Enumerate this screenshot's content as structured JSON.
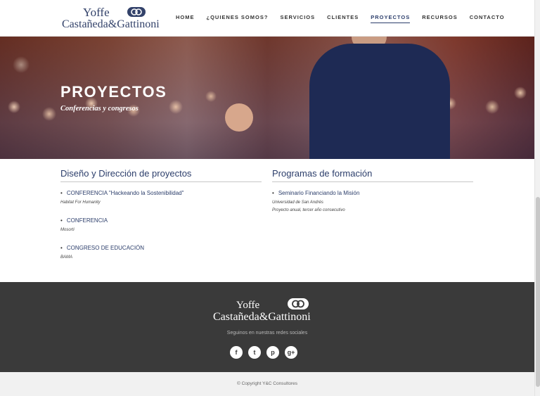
{
  "header": {
    "logo": {
      "line1": "Yoffe",
      "line2": "Castañeda&Gattinoni"
    },
    "nav": [
      {
        "label": "HOME"
      },
      {
        "label": "¿QUIENES SOMOS?"
      },
      {
        "label": "SERVICIOS"
      },
      {
        "label": "CLIENTES"
      },
      {
        "label": "PROYECTOS",
        "active": true
      },
      {
        "label": "RECURSOS"
      },
      {
        "label": "CONTACTO"
      }
    ]
  },
  "hero": {
    "title": "PROYECTOS",
    "subtitle": "Conferencias y congresos"
  },
  "sections": {
    "left": {
      "heading": "Diseño y Dirección de proyectos",
      "items": [
        {
          "title": "CONFERENCIA \"Hackeando la Sostenibilidad\"",
          "meta": [
            "Habitat For Humanity"
          ]
        },
        {
          "title": "CONFERENCIA",
          "meta": [
            "Mosorti"
          ]
        },
        {
          "title": "CONGRESO DE EDUCACIÓN",
          "meta": [
            "BAMA"
          ]
        }
      ]
    },
    "right": {
      "heading": "Programas de formación",
      "items": [
        {
          "title": "Seminario Financiando la Misión",
          "meta": [
            "Universidad de San Andrés",
            "Proyecto anual, tercer año consecutivo"
          ]
        }
      ]
    }
  },
  "footer": {
    "logo": {
      "line1": "Yoffe",
      "line2": "Castañeda&Gattinoni"
    },
    "follow_text": "Seguinos en nuestras redes sociales",
    "social": [
      {
        "icon": "facebook-icon",
        "glyph": "f"
      },
      {
        "icon": "twitter-icon",
        "glyph": "t"
      },
      {
        "icon": "pinterest-icon",
        "glyph": "p"
      },
      {
        "icon": "google-plus-icon",
        "glyph": "g+"
      }
    ],
    "copyright": "© Copyright Y&C Consultores"
  },
  "colors": {
    "brand": "#2c3e6b",
    "footer_bg": "#3a3a3a",
    "bottom_bg": "#f1f1f1"
  }
}
